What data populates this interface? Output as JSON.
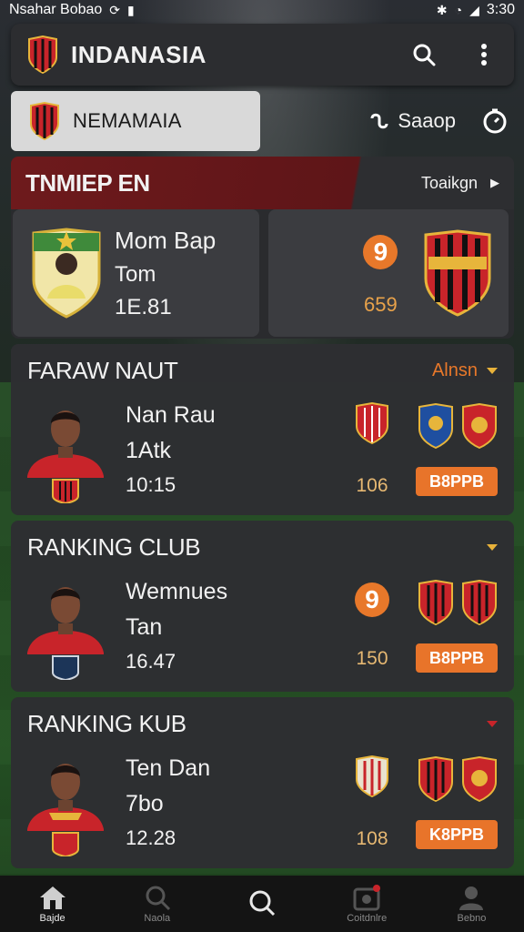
{
  "status_bar": {
    "left_text": "Nsahar Bobao",
    "time": "3:30"
  },
  "app_bar": {
    "title": "INDANASIA",
    "search_icon": "search-icon",
    "menu_icon": "more-vertical-icon"
  },
  "league": {
    "name": "NEMAMAIA",
    "stage_label": "Saaop"
  },
  "featured": {
    "title": "TNMIEP EN",
    "link_label": "Toaikgn",
    "player_lines": [
      "Mom Bap",
      "Tom",
      "1E.81"
    ],
    "score": "9",
    "score_sub": "659"
  },
  "rankings": [
    {
      "title": "FARAW NAUT",
      "filter": "Alnsn",
      "lines": [
        "Nan Rau",
        "1Atk",
        "10:15"
      ],
      "mid_value": "106",
      "mid_icon": "crest",
      "button": "B8PPB"
    },
    {
      "title": "RANKING CLUB",
      "filter": "",
      "lines": [
        "Wemnues",
        "Tan",
        "16.47"
      ],
      "mid_value": "150",
      "mid_icon": "score",
      "mid_score": "9",
      "button": "B8PPB"
    },
    {
      "title": "RANKING KUB",
      "filter": "",
      "lines": [
        "Ten Dan",
        "7bo",
        "12.28"
      ],
      "mid_value": "108",
      "mid_icon": "crest",
      "button": "K8PPB"
    }
  ],
  "nav": [
    {
      "label": "Bajde",
      "icon": "home-icon",
      "active": true
    },
    {
      "label": "Naola",
      "icon": "search-icon",
      "active": false
    },
    {
      "label": "",
      "icon": "search-icon",
      "active": false
    },
    {
      "label": "Coitdnlre",
      "icon": "calendar-icon",
      "active": false
    },
    {
      "label": "Bebno",
      "icon": "profile-icon",
      "active": false
    }
  ],
  "colors": {
    "accent": "#e8742a",
    "header_red": "#6e1a1c",
    "card": "#2d2e32"
  }
}
